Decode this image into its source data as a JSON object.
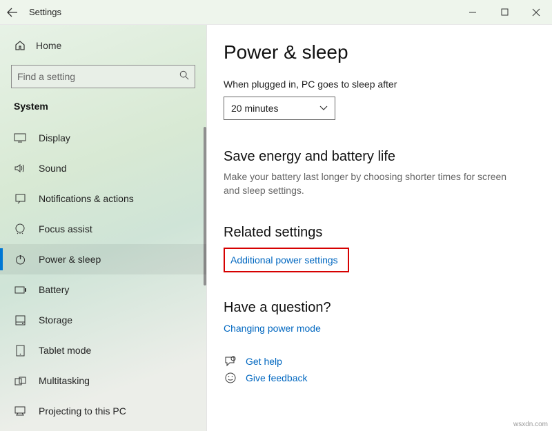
{
  "titlebar": {
    "title": "Settings"
  },
  "sidebar": {
    "home": "Home",
    "search_placeholder": "Find a setting",
    "section": "System",
    "items": [
      {
        "label": "Display"
      },
      {
        "label": "Sound"
      },
      {
        "label": "Notifications & actions"
      },
      {
        "label": "Focus assist"
      },
      {
        "label": "Power & sleep"
      },
      {
        "label": "Battery"
      },
      {
        "label": "Storage"
      },
      {
        "label": "Tablet mode"
      },
      {
        "label": "Multitasking"
      },
      {
        "label": "Projecting to this PC"
      }
    ]
  },
  "main": {
    "heading": "Power & sleep",
    "sleep_label": "When plugged in, PC goes to sleep after",
    "sleep_value": "20 minutes",
    "save_heading": "Save energy and battery life",
    "save_text": "Make your battery last longer by choosing shorter times for screen and sleep settings.",
    "related_heading": "Related settings",
    "related_link": "Additional power settings",
    "question_heading": "Have a question?",
    "question_link": "Changing power mode",
    "help_links": [
      {
        "label": "Get help"
      },
      {
        "label": "Give feedback"
      }
    ]
  },
  "watermark": "wsxdn.com"
}
